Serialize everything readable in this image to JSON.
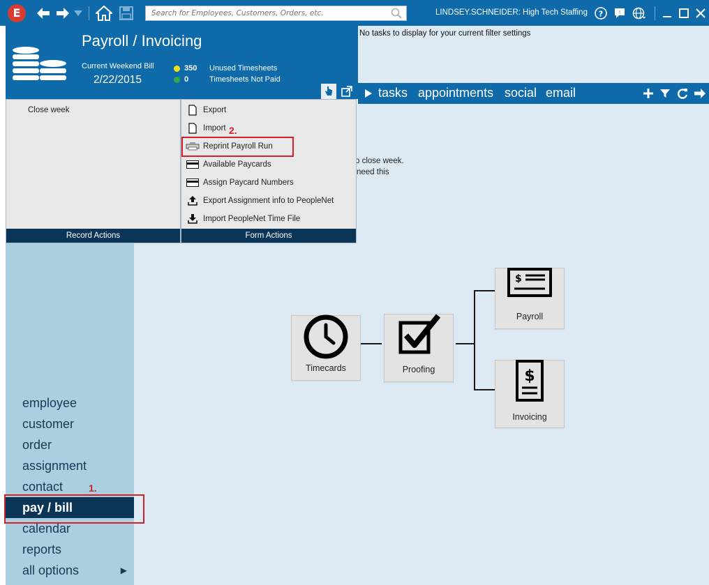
{
  "topbar": {
    "search_placeholder": "Search for Employees, Customers, Orders, etc.",
    "user_label": "LINDSEY.SCHNEIDER: High Tech Staffing",
    "logo_letter": "E"
  },
  "header": {
    "title": "Payroll / Invoicing",
    "bill_label": "Current Weekend Bill",
    "bill_date": "2/22/2015",
    "stats": [
      {
        "value": "350",
        "label": "Unused Timesheets",
        "color": "#f2e11a"
      },
      {
        "value": "0",
        "label": "Timesheets Not Paid",
        "color": "#2fa84f"
      }
    ]
  },
  "tasks": {
    "empty_message": "No tasks to display for your current filter settings",
    "tabs": [
      "tasks",
      "appointments",
      "social",
      "email"
    ]
  },
  "record_actions": {
    "items": [
      "Close week"
    ],
    "footer": "Record Actions"
  },
  "form_actions": {
    "items": [
      {
        "label": "Export",
        "icon": "document-icon"
      },
      {
        "label": "Import",
        "icon": "document-icon"
      },
      {
        "label": "Reprint Payroll Run",
        "icon": "printer-icon"
      },
      {
        "label": "Available Paycards",
        "icon": "card-icon"
      },
      {
        "label": "Assign Paycard Numbers",
        "icon": "card-icon"
      },
      {
        "label": "Export Assignment info to PeopleNet",
        "icon": "upload-icon"
      },
      {
        "label": "Import PeopleNet Time File",
        "icon": "download-icon"
      }
    ],
    "footer": "Form Actions"
  },
  "behind_text": {
    "line1": "o close week.",
    "line2": "need this"
  },
  "nav": {
    "items": [
      "employee",
      "customer",
      "order",
      "assignment",
      "contact",
      "pay / bill",
      "calendar",
      "reports",
      "all options"
    ],
    "active": "pay / bill"
  },
  "annotations": {
    "step1": "1.",
    "step2": "2."
  },
  "workflow": {
    "timecards": "Timecards",
    "proofing": "Proofing",
    "payroll": "Payroll",
    "invoicing": "Invoicing"
  },
  "colors": {
    "primary": "#0e6aa8",
    "dark": "#0b3556",
    "annotation": "#d31f26"
  }
}
